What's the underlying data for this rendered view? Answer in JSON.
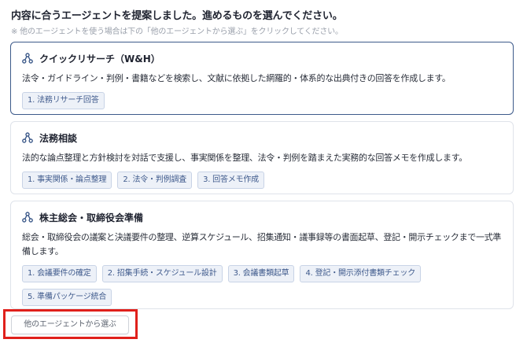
{
  "header": {
    "title": "内容に合うエージェントを提案しました。進めるものを選んでください。",
    "note": "※ 他のエージェントを使う場合は下の「他のエージェントから選ぶ」をクリックしてください。"
  },
  "agents": [
    {
      "title": "クイックリサーチ（W&H）",
      "icon": "agent-network-icon",
      "description": "法令・ガイドライン・判例・書籍などを検索し、文献に依拠した網羅的・体系的な出典付きの回答を作成します。",
      "steps": [
        "1. 法務リサーチ回答"
      ],
      "selected": true
    },
    {
      "title": "法務相談",
      "icon": "agent-network-icon",
      "description": "法的な論点整理と方針検討を対話で支援し、事実関係を整理、法令・判例を踏まえた実務的な回答メモを作成します。",
      "steps": [
        "1. 事実関係・論点整理",
        "2. 法令・判例調査",
        "3. 回答メモ作成"
      ],
      "selected": false
    },
    {
      "title": "株主総会・取締役会準備",
      "icon": "agent-network-icon",
      "description": "総会・取締役会の議案と決議要件の整理、逆算スケジュール、招集通知・議事録等の書面起草、登記・開示チェックまで一式準備します。",
      "steps": [
        "1. 会議要件の確定",
        "2. 招集手続・スケジュール設計",
        "3. 会議書類起草",
        "4. 登記・開示添付書類チェック",
        "5. 準備パッケージ統合"
      ],
      "selected": false
    }
  ],
  "footer": {
    "other_agents_label": "他のエージェントから選ぶ"
  },
  "colors": {
    "selected_border": "#3d5a8a",
    "tag_text": "#3f5a8c",
    "tag_bg": "#edf1f8",
    "highlight_box": "#e0201b"
  }
}
